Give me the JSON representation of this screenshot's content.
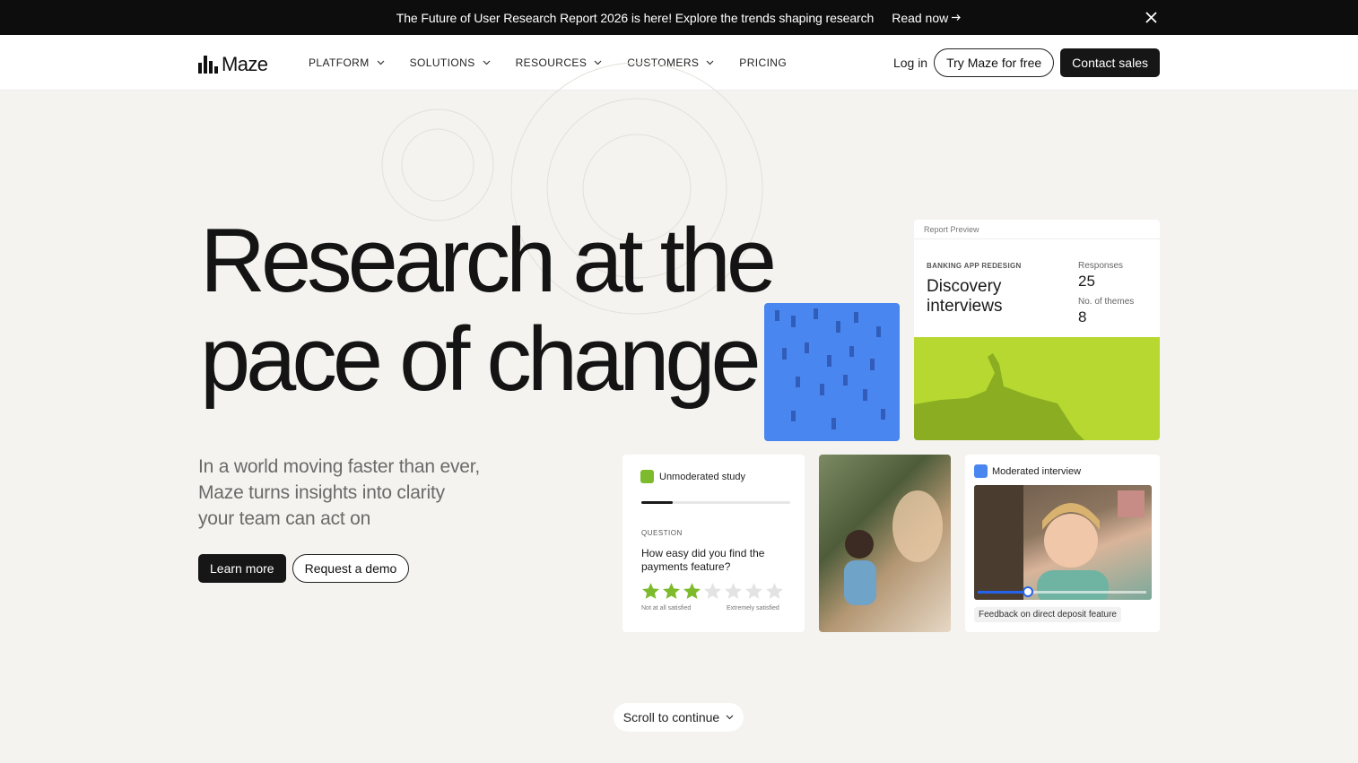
{
  "announcement": {
    "message": "The Future of User Research Report 2026 is here! Explore the trends shaping research",
    "link_label": "Read now",
    "link_icon": "arrow-right-icon",
    "close_icon": "close-icon"
  },
  "nav": {
    "logo_text": "Maze",
    "items": [
      {
        "label": "PLATFORM",
        "has_dropdown": true
      },
      {
        "label": "SOLUTIONS",
        "has_dropdown": true
      },
      {
        "label": "RESOURCES",
        "has_dropdown": true
      },
      {
        "label": "CUSTOMERS",
        "has_dropdown": true
      },
      {
        "label": "PRICING",
        "has_dropdown": false
      }
    ],
    "login_label": "Log in",
    "try_label": "Try Maze for free",
    "contact_label": "Contact sales"
  },
  "hero": {
    "headline_line1": "Research at the",
    "headline_line2": "pace of change",
    "sub_line1": "In a world moving faster than ever,",
    "sub_line2": "Maze turns insights into clarity",
    "sub_line3": "your team can act on",
    "learn_more_label": "Learn more",
    "demo_label": "Request a demo"
  },
  "report_card": {
    "header": "Report Preview",
    "tag": "BANKING APP REDESIGN",
    "title_line1": "Discovery",
    "title_line2": "interviews",
    "responses_label": "Responses",
    "responses_value": "25",
    "themes_label": "No. of themes",
    "themes_value": "8"
  },
  "unmoderated_card": {
    "label": "Unmoderated study",
    "progress": 0.21,
    "question_label": "QUESTION",
    "question_text": "How easy did you find the payments feature?",
    "rating": 3,
    "rating_max": 7,
    "low_label": "Not at all satisfied",
    "high_label": "Extremely satisfied",
    "star_color": "#7dbb2c",
    "star_empty_color": "#e3e3e3"
  },
  "moderated_card": {
    "label": "Moderated interview",
    "playback_position": 0.3,
    "caption": "Feedback on direct deposit feature"
  },
  "scroll": {
    "label": "Scroll to continue",
    "icon": "chevron-down-icon"
  },
  "colors": {
    "accent_blue": "#4a86f0",
    "accent_green": "#b6d831",
    "dark": "#161616"
  }
}
